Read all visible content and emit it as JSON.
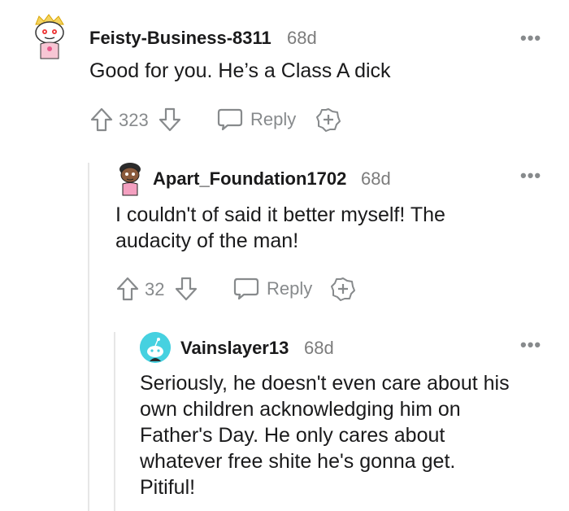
{
  "comments": [
    {
      "username": "Feisty-Business-8311",
      "time": "68d",
      "more": "•••",
      "lines": [
        "Good for you. He’s a Class A dick"
      ],
      "votes": "323",
      "reply_label": "Reply"
    },
    {
      "username": "Apart_Foundation1702",
      "time": "68d",
      "more": "•••",
      "lines": [
        "I couldn't of said it better myself! The",
        "audacity of the man!"
      ],
      "votes": "32",
      "reply_label": "Reply"
    },
    {
      "username": "Vainslayer13",
      "time": "68d",
      "more": "•••",
      "lines": [
        "Seriously, he doesn't even care about his",
        "own children acknowledging him on",
        "Father's Day. He only cares about",
        "whatever free shite he's gonna get.",
        "Pitiful!"
      ]
    }
  ],
  "colors": {
    "text": "#1a1a1b",
    "muted": "#878a8c",
    "thread_line": "#e6e6e6",
    "avatar_teal": "#46d1e0"
  }
}
